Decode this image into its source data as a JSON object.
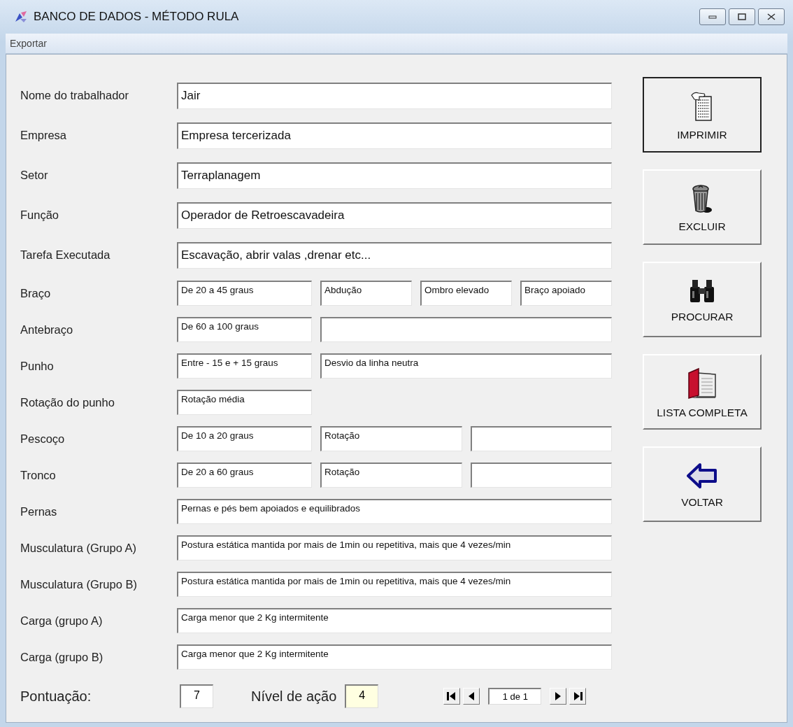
{
  "window": {
    "title": "BANCO DE DADOS - MÉTODO RULA"
  },
  "menu": [
    {
      "label": "Exportar"
    }
  ],
  "rows": [
    {
      "label": "Nome do trabalhador",
      "kind": "large",
      "fields": [
        {
          "value": "Jair"
        }
      ]
    },
    {
      "label": "Empresa",
      "kind": "large",
      "fields": [
        {
          "value": "Empresa tercerizada"
        }
      ]
    },
    {
      "label": "Setor",
      "kind": "large",
      "fields": [
        {
          "value": "Terraplanagem"
        }
      ]
    },
    {
      "label": "Função",
      "kind": "large",
      "fields": [
        {
          "value": "Operador de Retroescavadeira"
        }
      ]
    },
    {
      "label": "Tarefa Executada",
      "kind": "large",
      "fields": [
        {
          "value": "Escavação, abrir valas ,drenar etc..."
        }
      ]
    },
    {
      "label": "Braço",
      "kind": "split",
      "fields": [
        {
          "value": "De 20 a 45 graus"
        },
        {
          "value": "Abdução"
        },
        {
          "value": "Ombro elevado"
        },
        {
          "value": "Braço apoiado"
        }
      ]
    },
    {
      "label": "Antebraço",
      "kind": "split",
      "fields": [
        {
          "value": "De 60 a 100 graus"
        },
        {
          "kind": "blank"
        }
      ]
    },
    {
      "label": "Punho",
      "kind": "split",
      "fields": [
        {
          "value": "Entre - 15 e + 15 graus"
        },
        {
          "value": "Desvio da linha neutra"
        }
      ]
    },
    {
      "label": "Rotação do punho",
      "kind": "short",
      "fields": [
        {
          "value": "Rotação média"
        }
      ]
    },
    {
      "label": "Pescoço",
      "kind": "split",
      "fields": [
        {
          "value": "De 10 a 20 graus"
        },
        {
          "value": "Rotação"
        },
        {
          "kind": "blank"
        }
      ]
    },
    {
      "label": "Tronco",
      "kind": "split",
      "fields": [
        {
          "value": "De 20 a 60 graus"
        },
        {
          "value": "Rotação"
        },
        {
          "kind": "blank"
        }
      ]
    },
    {
      "label": "Pernas",
      "kind": "small",
      "fields": [
        {
          "value": "Pernas e pés bem apoiados e equilibrados"
        }
      ]
    },
    {
      "label": "Musculatura (Grupo A)",
      "kind": "small",
      "fields": [
        {
          "value": "Postura estática mantida por mais de 1min ou repetitiva, mais que 4 vezes/min"
        }
      ]
    },
    {
      "label": "Musculatura (Grupo B)",
      "kind": "small",
      "fields": [
        {
          "value": "Postura estática mantida por mais de 1min ou repetitiva, mais que 4 vezes/min"
        }
      ]
    },
    {
      "label": "Carga (grupo A)",
      "kind": "small",
      "fields": [
        {
          "value": "Carga menor que 2 Kg intermitente"
        }
      ]
    },
    {
      "label": "Carga (grupo B)",
      "kind": "small",
      "fields": [
        {
          "value": "Carga menor que 2 Kg intermitente"
        }
      ]
    }
  ],
  "buttons": [
    {
      "label": "IMPRIMIR",
      "default": true
    },
    {
      "label": "EXCLUIR",
      "default": false
    },
    {
      "label": "PROCURAR",
      "default": false
    },
    {
      "label": "LISTA COMPLETA",
      "default": false
    },
    {
      "label": "VOLTAR",
      "default": false
    }
  ],
  "footer": {
    "score_label": "Pontuação:",
    "score": "7",
    "action_label": "Nível de ação",
    "action_level": "4",
    "record": "1 de 1"
  }
}
